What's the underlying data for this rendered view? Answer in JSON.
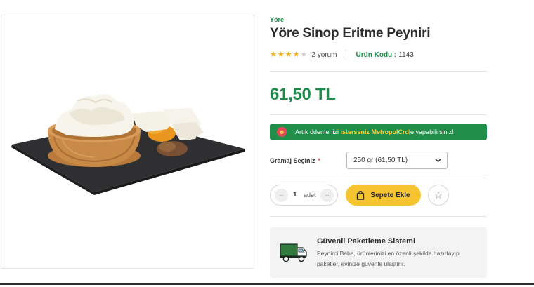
{
  "product": {
    "brand": "Yöre",
    "title": "Yöre Sinop Eritme Peyniri",
    "image_icon": "cheese-product-photo",
    "rating": {
      "stars_filled": 4,
      "stars_total": 5,
      "review_text": "2 yorum"
    },
    "code": {
      "label": "Ürün Kodu :",
      "value": "1143"
    },
    "price": "61,50 TL"
  },
  "promo": {
    "icon": "smile-icon",
    "prefix": "Artık ödemenizi ",
    "highlight": "isterseniz MetropolCrd",
    "suffix": "le yapabilirsiniz!"
  },
  "gramaj": {
    "label": "Gramaj Seçiniz",
    "required_mark": "*",
    "selected": "250 gr (61,50 TL)"
  },
  "quantity": {
    "minus": "−",
    "value": "1",
    "unit": "adet",
    "plus": "+"
  },
  "actions": {
    "add_to_cart": "Sepete Ekle",
    "favorite_icon": "star-outline-icon"
  },
  "packaging": {
    "icon": "truck-icon",
    "title": "Güvenli Paketleme Sistemi",
    "text": "Peynirci Baba, ürünlerinizi en özenli şekilde hazırlayıp paketler, evinize güvenle ulaştırır."
  },
  "colors": {
    "brand_green": "#1f8a4c",
    "promo_bg": "#1f8f4a",
    "cart_yellow": "#f6c431",
    "star": "#f2b01e"
  }
}
